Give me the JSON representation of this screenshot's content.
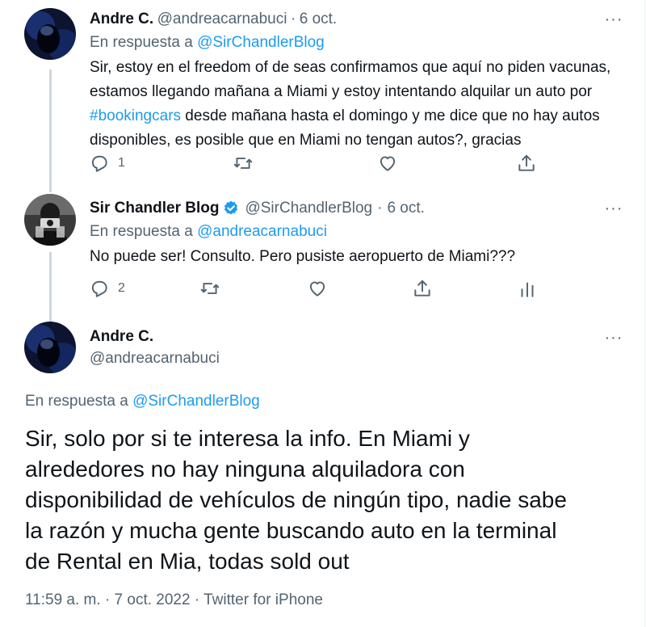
{
  "tweet1": {
    "name": "Andre C.",
    "handle": "@andreacarnabuci",
    "sep": "·",
    "date": "6 oct.",
    "reply_prefix": "En respuesta a",
    "reply_to": "@SirChandlerBlog",
    "text_before": "Sir, estoy en el freedom of de seas  confirmamos que aquí no piden vacunas, estamos llegando mañana a Miami y estoy intentando alquilar un auto por ",
    "hashtag": "#bookingcars",
    "text_after": " desde mañana hasta el domingo y me dice que no hay autos disponibles, es posible que en Miami no tengan autos?, gracias",
    "reply_count": "1",
    "retweet_count": "",
    "like_count": ""
  },
  "tweet2": {
    "name": "Sir Chandler Blog",
    "handle": "@SirChandlerBlog",
    "sep": "·",
    "date": "6 oct.",
    "reply_prefix": "En respuesta a",
    "reply_to": "@andreacarnabuci",
    "text": "No puede ser! Consulto. Pero pusiste aeropuerto de Miami???",
    "reply_count": "2",
    "retweet_count": "",
    "like_count": ""
  },
  "main": {
    "name": "Andre C.",
    "handle": "@andreacarnabuci",
    "reply_prefix": "En respuesta a",
    "reply_to": "@SirChandlerBlog",
    "lines": [
      "Sir, solo por si te interesa la info. En Miami y",
      "alrededores no hay ninguna alquiladora con",
      "disponibilidad de vehículos de ningún tipo, nadie sabe",
      "la razón y mucha gente buscando auto en la terminal",
      "de Rental en Mia, todas sold out"
    ],
    "time": "11:59 a. m.",
    "date": "7 oct. 2022",
    "source": "Twitter for iPhone",
    "sep": "·"
  },
  "more_label": "···",
  "icons": {
    "reply": "reply-icon",
    "retweet": "retweet-icon",
    "like": "like-icon",
    "share": "share-icon",
    "analytics": "analytics-icon",
    "verified": "verified-badge-icon"
  },
  "colors": {
    "link": "#1d9bf0",
    "muted": "#536471",
    "text": "#0f1419",
    "thread_line": "#cfd9de"
  }
}
